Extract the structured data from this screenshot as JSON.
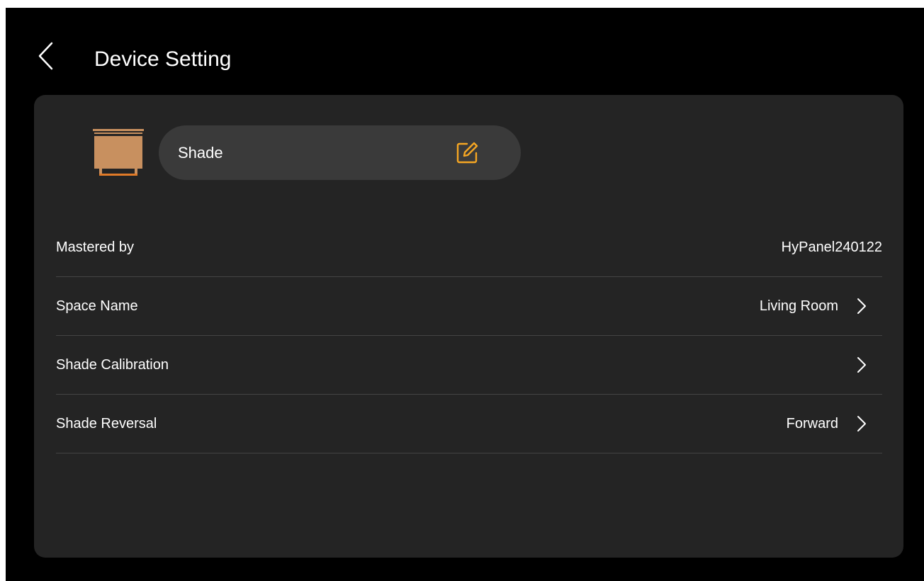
{
  "header": {
    "title": "Device Setting",
    "back_icon": "chevron-left-icon"
  },
  "device": {
    "name": "Shade",
    "icon": "shade-device-icon",
    "edit_icon": "edit-icon",
    "icon_color": "#c8905f",
    "accent": "#f5a623"
  },
  "settings": {
    "rows": [
      {
        "label": "Mastered by",
        "value": "HyPanel240122",
        "has_arrow": false
      },
      {
        "label": "Space Name",
        "value": "Living Room",
        "has_arrow": true
      },
      {
        "label": "Shade Calibration",
        "value": "",
        "has_arrow": true
      },
      {
        "label": "Shade Reversal",
        "value": "Forward",
        "has_arrow": true
      }
    ]
  },
  "colors": {
    "background": "#000000",
    "card": "#242424",
    "pill": "#3a3a3a",
    "divider": "#444444",
    "text": "#ffffff"
  }
}
